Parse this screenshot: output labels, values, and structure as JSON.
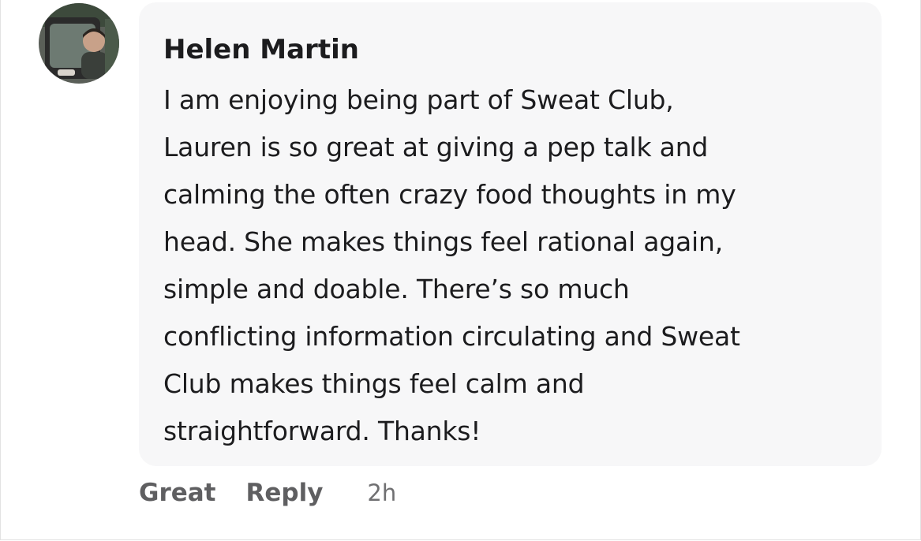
{
  "comment": {
    "author": "Helen Martin",
    "text_lines": [
      "I am enjoying being part of Sweat Club,",
      "Lauren is so great at giving a pep talk and",
      "calming the often crazy food thoughts in my",
      "head. She makes things feel rational again,",
      "simple and doable. There’s so much",
      "conflicting information circulating and Sweat",
      "Club makes things feel calm and",
      "straightforward. Thanks!"
    ],
    "actions": {
      "react_label": "Great",
      "reply_label": "Reply"
    },
    "timestamp": "2h"
  },
  "colors": {
    "bubble_background": "#f7f7f8",
    "text": "#1c1c1e",
    "action_text": "#5f5f61"
  }
}
